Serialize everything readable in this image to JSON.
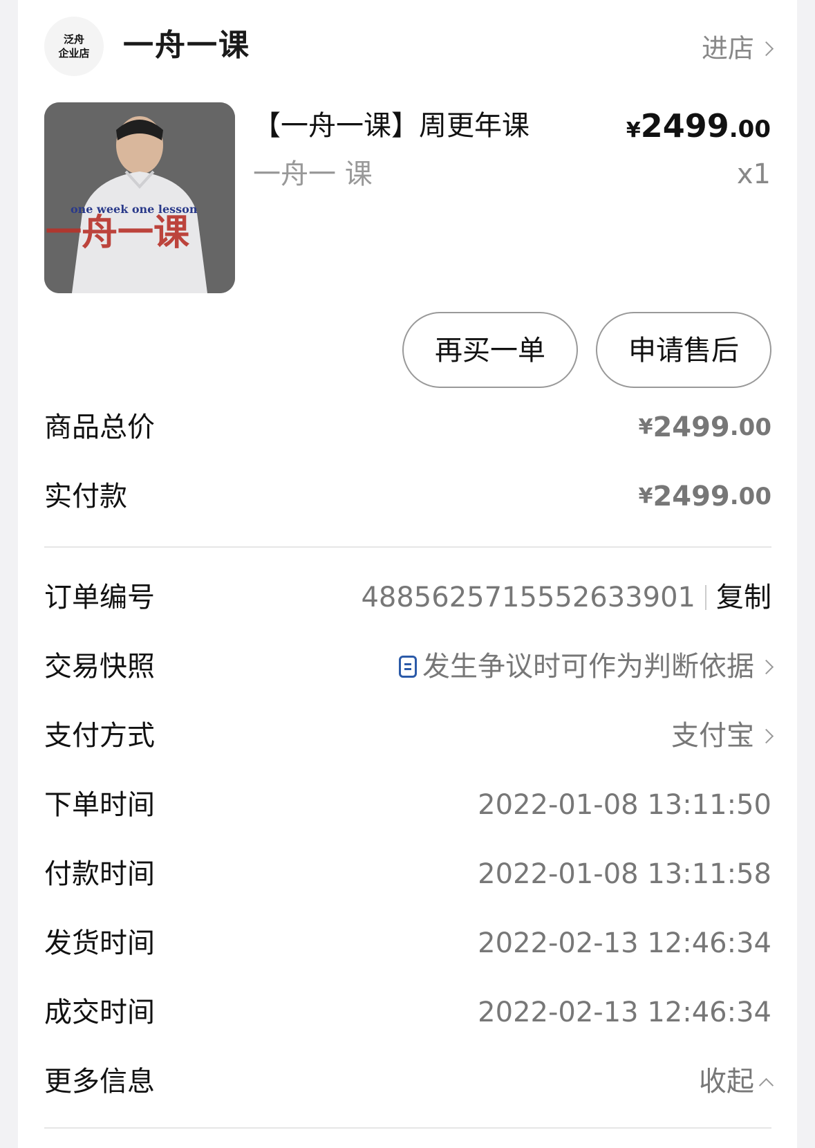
{
  "shop": {
    "logo_line1": "泛舟",
    "logo_line2": "企业店",
    "name": "一舟一课",
    "enter_label": "进店"
  },
  "product": {
    "title": "【一舟一课】周更年课",
    "subtitle": "一舟一 课",
    "price_currency": "¥",
    "price_int": "2499",
    "price_dec": ".00",
    "quantity": "x1",
    "image_text_line1": "one week one lesson",
    "image_text_line2": "一舟一课"
  },
  "actions": {
    "rebuy_label": "再买一单",
    "after_sale_label": "申请售后"
  },
  "summary": {
    "total_label": "商品总价",
    "total_currency": "¥",
    "total_int": "2499",
    "total_dec": ".00",
    "paid_label": "实付款",
    "paid_currency": "¥",
    "paid_int": "2499",
    "paid_dec": ".00"
  },
  "details": {
    "order_no_label": "订单编号",
    "order_no": "4885625715552633901",
    "copy_label": "复制",
    "snapshot_label": "交易快照",
    "snapshot_value": "发生争议时可作为判断依据",
    "payment_label": "支付方式",
    "payment_value": "支付宝",
    "order_time_label": "下单时间",
    "order_time": "2022-01-08 13:11:50",
    "pay_time_label": "付款时间",
    "pay_time": "2022-01-08 13:11:58",
    "ship_time_label": "发货时间",
    "ship_time": "2022-02-13 12:46:34",
    "deal_time_label": "成交时间",
    "deal_time": "2022-02-13 12:46:34",
    "more_label": "更多信息",
    "collapse_label": "收起"
  },
  "colors": {
    "accent_red": "#e0404c",
    "link_blue": "#2b5aa8"
  }
}
